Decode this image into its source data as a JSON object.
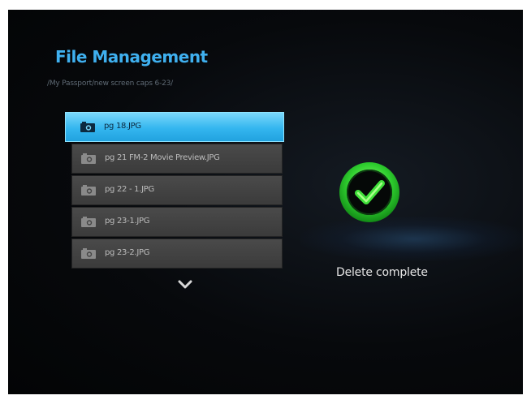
{
  "header": {
    "title": "File Management",
    "path": "/My Passport/new screen caps 6-23/"
  },
  "files": {
    "items": [
      {
        "name": "pg 18.JPG",
        "icon": "camera-icon",
        "selected": true
      },
      {
        "name": "pg 21 FM-2 Movie Preview.JPG",
        "icon": "camera-icon",
        "selected": false
      },
      {
        "name": "pg 22 - 1.JPG",
        "icon": "camera-icon",
        "selected": false
      },
      {
        "name": "pg 23-1.JPG",
        "icon": "camera-icon",
        "selected": false
      },
      {
        "name": "pg 23-2.JPG",
        "icon": "camera-icon",
        "selected": false
      }
    ],
    "more_icon": "chevron-down-icon"
  },
  "result": {
    "icon": "success-check-icon",
    "message": "Delete complete"
  },
  "colors": {
    "accent": "#3fb0ef",
    "selected_row": "#34b6ef",
    "success_green": "#2fcf2f"
  }
}
